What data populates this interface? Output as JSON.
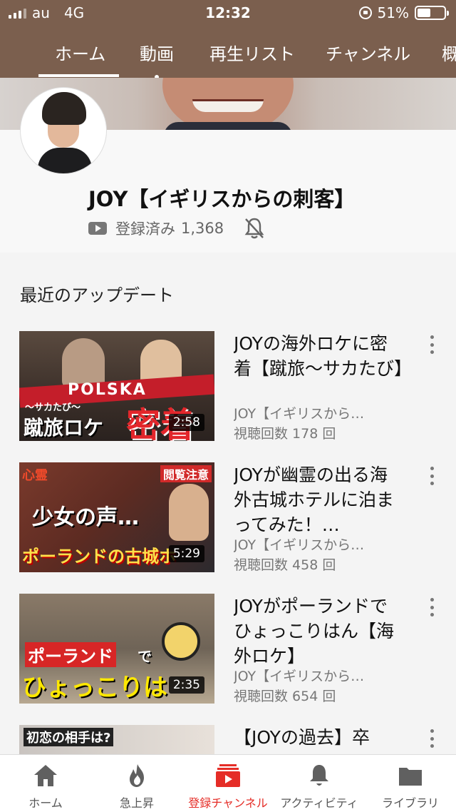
{
  "status_bar": {
    "carrier": "au",
    "network": "4G",
    "time": "12:32",
    "battery": "51%",
    "battery_level": 0.51
  },
  "tabs": [
    {
      "label": "ホーム",
      "active": true
    },
    {
      "label": "動画",
      "has_dot": true
    },
    {
      "label": "再生リスト"
    },
    {
      "label": "チャンネル"
    },
    {
      "label": "概"
    }
  ],
  "channel": {
    "name": "JOY【イギリスからの刺客】",
    "subscribed_label": "登録済み",
    "subscriber_count": "1,368"
  },
  "section_title": "最近のアップデート",
  "videos": [
    {
      "title": "JOYの海外ロケに密着【蹴旅〜サカたび】",
      "channel": "JOY【イギリスから…",
      "views": "視聴回数 178 回",
      "duration": "2:58",
      "thumb_text": [
        "POLSKA",
        "〜サカたび〜",
        "蹴旅ロケ",
        "密着"
      ]
    },
    {
      "title": "JOYが幽霊の出る海外古城ホテルに泊まってみた！…",
      "channel": "JOY【イギリスから…",
      "views": "視聴回数 458 回",
      "duration": "5:29",
      "thumb_text": [
        "心霊",
        "閲覧注意",
        "少女の声…",
        "ポーランドの古城ホ"
      ]
    },
    {
      "title": "JOYがポーランドでひょっこりはん【海外ロケ】",
      "channel": "JOY【イギリスから…",
      "views": "視聴回数 654 回",
      "duration": "2:35",
      "thumb_text": [
        "ポーランド",
        "で",
        "ひょっこりは"
      ]
    },
    {
      "title": "【JOYの過去】卒",
      "thumb_text": [
        "初恋の相手は?"
      ]
    }
  ],
  "bottom_nav": [
    {
      "label": "ホーム",
      "icon": "home-icon"
    },
    {
      "label": "急上昇",
      "icon": "flame-icon"
    },
    {
      "label": "登録チャンネル",
      "icon": "subscriptions-icon",
      "active": true
    },
    {
      "label": "アクティビティ",
      "icon": "bell-icon"
    },
    {
      "label": "ライブラリ",
      "icon": "folder-icon"
    }
  ],
  "colors": {
    "header": "#7b5f4e",
    "accent": "#e52d27"
  }
}
